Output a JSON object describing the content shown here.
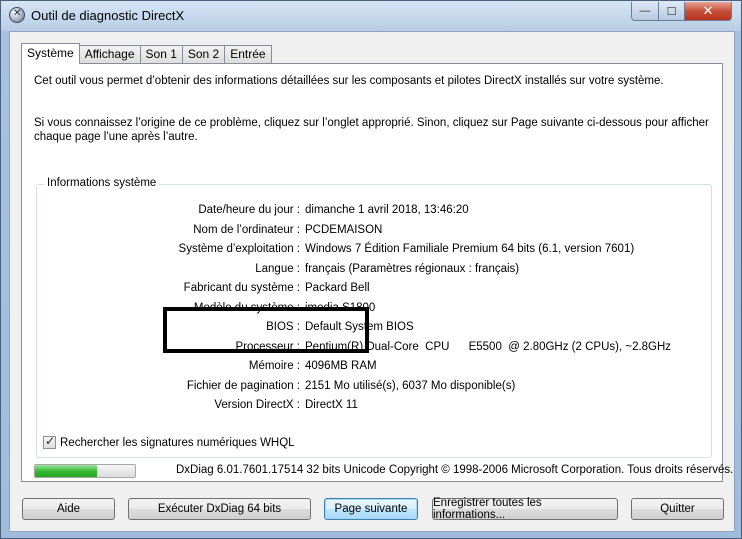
{
  "window": {
    "title": "Outil de diagnostic DirectX",
    "controls": {
      "minimize": "—",
      "maximize": "☐",
      "close": "✕"
    }
  },
  "tabs": [
    {
      "label": "Système",
      "active": true
    },
    {
      "label": "Affichage",
      "active": false
    },
    {
      "label": "Son 1",
      "active": false
    },
    {
      "label": "Son 2",
      "active": false
    },
    {
      "label": "Entrée",
      "active": false
    }
  ],
  "intro": {
    "line1": "Cet outil vous permet d’obtenir des informations détaillées sur les composants et pilotes DirectX installés sur votre système.",
    "line2": "Si vous connaissez l’origine de ce problème, cliquez sur l’onglet approprié. Sinon, cliquez sur Page suivante ci-dessous pour afficher chaque page l’une après l’autre."
  },
  "system_info": {
    "group_label": "Informations système",
    "rows": [
      {
        "label": "Date/heure du jour :",
        "value": "dimanche 1 avril 2018, 13:46:20"
      },
      {
        "label": "Nom de l’ordinateur :",
        "value": "PCDEMAISON"
      },
      {
        "label": "Système d’exploitation :",
        "value": "Windows 7 Édition Familiale Premium 64 bits (6.1, version 7601)"
      },
      {
        "label": "Langue :",
        "value": "français (Paramètres régionaux : français)"
      },
      {
        "label": "Fabricant du système :",
        "value": "Packard Bell"
      },
      {
        "label": "Modèle du système :",
        "value": "imedia S1800"
      },
      {
        "label": "BIOS :",
        "value": "Default System BIOS"
      },
      {
        "label": "Processeur :",
        "value": "Pentium(R) Dual-Core  CPU      E5500  @ 2.80GHz (2 CPUs), ~2.8GHz"
      },
      {
        "label": "Mémoire :",
        "value": "4096MB RAM"
      },
      {
        "label": "Fichier de pagination :",
        "value": "2151 Mo utilisé(s), 6037 Mo disponible(s)"
      },
      {
        "label": "Version DirectX :",
        "value": "DirectX 11"
      }
    ],
    "whql_label": "Rechercher les signatures numériques WHQL",
    "whql_checked": true
  },
  "status": {
    "progress_fraction": 0.62,
    "text": "DxDiag 6.01.7601.17514 32 bits Unicode Copyright © 1998-2006 Microsoft Corporation. Tous droits réservés."
  },
  "buttons": {
    "help": "Aide",
    "run64": "Exécuter DxDiag 64 bits",
    "next_page": "Page suivante",
    "save_all": "Enregistrer toutes les informations...",
    "quit": "Quitter"
  },
  "colors": {
    "title_bar": "#b7cde6",
    "close_button": "#c7503a",
    "progress_fill": "#35b935",
    "highlight_box": "#000000"
  }
}
